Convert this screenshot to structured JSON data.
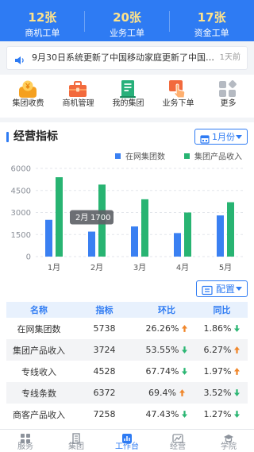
{
  "header": {
    "stats": [
      {
        "value": "12张",
        "label": "商机工单"
      },
      {
        "value": "20张",
        "label": "业务工单"
      },
      {
        "value": "17张",
        "label": "资金工单"
      }
    ]
  },
  "notice": {
    "icon": "speaker-icon",
    "text": "9月30日系统更新了中国移动家庭更新了中国…",
    "time": "1天前"
  },
  "quick_menu": [
    {
      "label": "集团收费",
      "icon": "group-fee-icon"
    },
    {
      "label": "商机管理",
      "icon": "briefcase-icon"
    },
    {
      "label": "我的集团",
      "icon": "building-icon"
    },
    {
      "label": "业务下单",
      "icon": "order-hand-icon"
    },
    {
      "label": "更多",
      "icon": "more-grid-icon"
    }
  ],
  "section": {
    "title": "经营指标",
    "month_select": "1月份",
    "config_select": "配置"
  },
  "chart_data": {
    "type": "bar",
    "categories": [
      "1月",
      "2月",
      "3月",
      "4月",
      "5月"
    ],
    "series": [
      {
        "name": "在网集团数",
        "values": [
          2500,
          1700,
          2050,
          1600,
          2800
        ],
        "color": "#3a80f2"
      },
      {
        "name": "集团产品收入",
        "values": [
          5400,
          4900,
          3900,
          3000,
          3700
        ],
        "color": "#28b472"
      }
    ],
    "yticks": [
      0,
      1500,
      3000,
      4500,
      6000
    ],
    "ylim": [
      0,
      6000
    ],
    "grid": true,
    "legend": "top-right",
    "tooltip": {
      "label": "2月",
      "value": "1700"
    }
  },
  "table": {
    "headers": [
      "名称",
      "指标",
      "环比",
      "同比"
    ],
    "rows": [
      {
        "name": "在网集团数",
        "value": "5738",
        "mom": "26.26%",
        "mom_icon": "arrow-up-icon",
        "yoy": "1.86%",
        "yoy_icon": "arrow-down-icon"
      },
      {
        "name": "集团产品收入",
        "value": "3724",
        "mom": "53.55%",
        "mom_icon": "arrow-down-icon",
        "yoy": "6.27%",
        "yoy_icon": "arrow-up-icon"
      },
      {
        "name": "专线收入",
        "value": "4528",
        "mom": "67.74%",
        "mom_icon": "arrow-down-icon",
        "yoy": "1.97%",
        "yoy_icon": "arrow-up-icon"
      },
      {
        "name": "专线条数",
        "value": "6372",
        "mom": "69.4%",
        "mom_icon": "arrow-up-icon",
        "yoy": "3.52%",
        "yoy_icon": "arrow-down-icon"
      },
      {
        "name": "商客产品收入",
        "value": "7258",
        "mom": "47.43%",
        "mom_icon": "arrow-down-icon",
        "yoy": "1.27%",
        "yoy_icon": "arrow-down-icon"
      }
    ]
  },
  "tabbar": {
    "tabs": [
      {
        "label": "服务",
        "icon": "service-grid-icon",
        "active": false
      },
      {
        "label": "集团",
        "icon": "group-building-icon",
        "active": false
      },
      {
        "label": "工作台",
        "icon": "workbench-chart-icon",
        "active": true
      },
      {
        "label": "经营",
        "icon": "business-trend-icon",
        "active": false
      },
      {
        "label": "学院",
        "icon": "academy-cap-icon",
        "active": false
      }
    ]
  },
  "colors": {
    "primary": "#2e7bf3",
    "stat_value": "#ffe38a",
    "up": "#f0862a",
    "down": "#2bb673"
  }
}
